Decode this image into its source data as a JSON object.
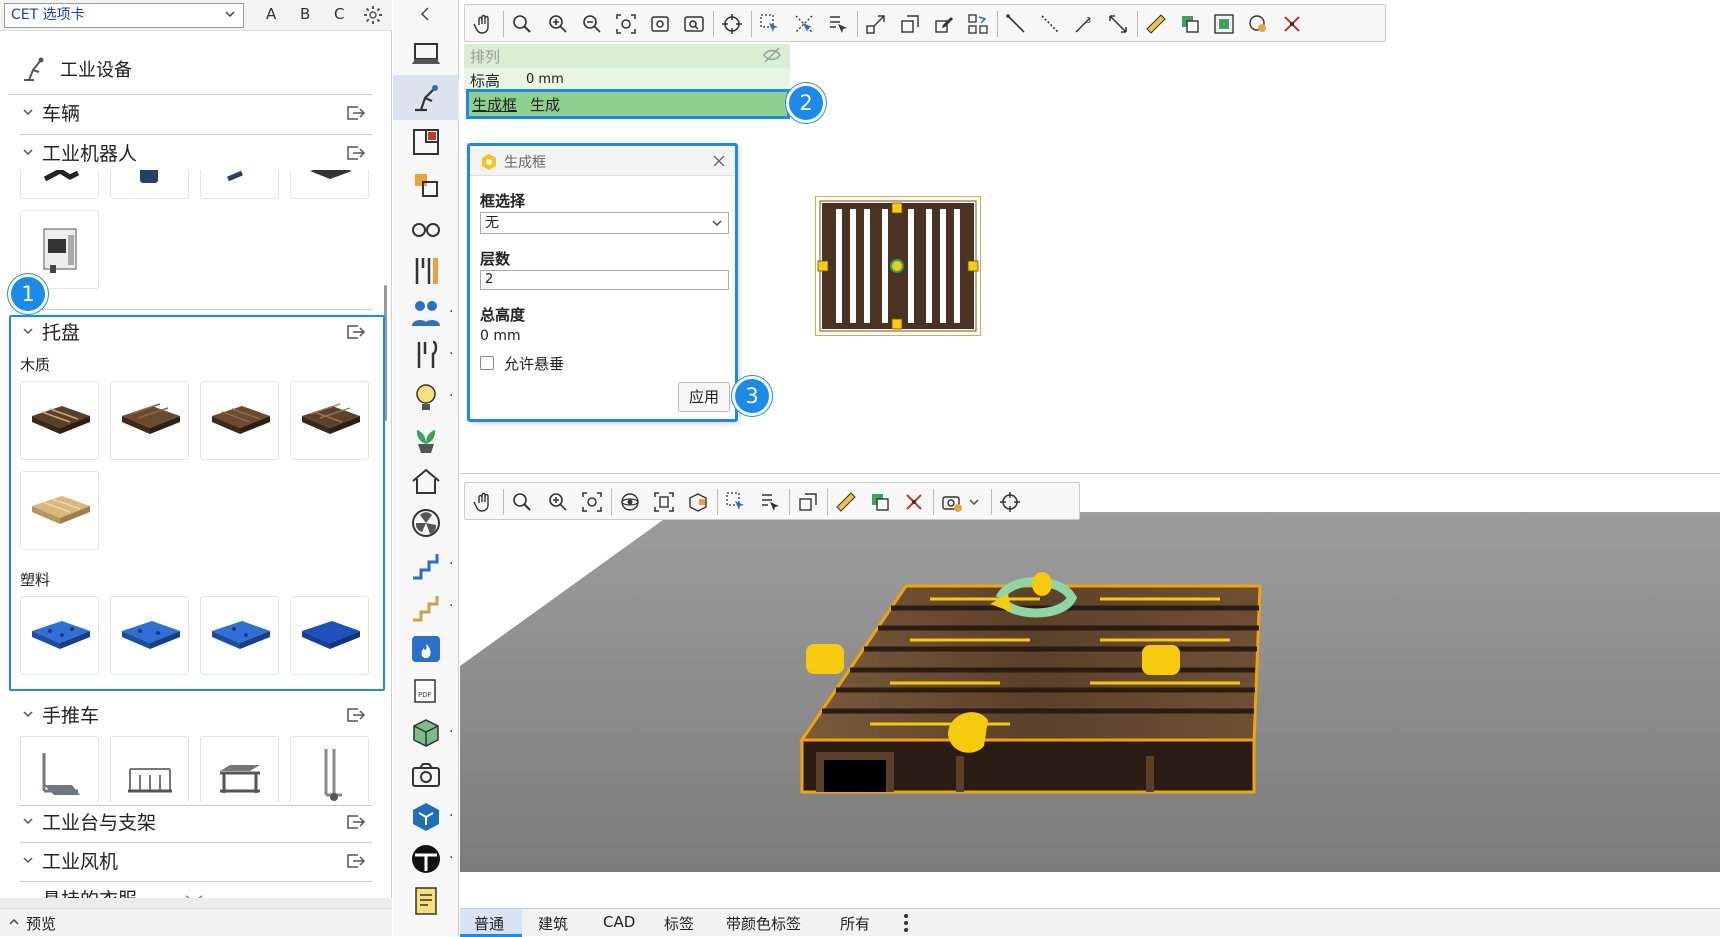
{
  "app": {
    "tab_selector": "CET 选项卡",
    "letters": [
      "A",
      "B",
      "C"
    ],
    "collapse_glyph": "‹"
  },
  "library": {
    "header": "工业设备",
    "categories": {
      "vehicles": "车辆",
      "robots": "工业机器人",
      "pallets": "托盘",
      "trolleys": "手推车",
      "workbench": "工业台与支架",
      "fans": "工业风机",
      "partial": "悬挂的衣服"
    },
    "pallet_sub": {
      "wood": "木质",
      "plastic": "塑料"
    },
    "preview": "预览"
  },
  "markers": [
    "1",
    "2",
    "3"
  ],
  "properties": {
    "row1_label": "排列",
    "row2_label": "标高",
    "row2_value": "0 mm",
    "row3_label": "生成框",
    "row3_value": "生成"
  },
  "dialog": {
    "title": "生成框",
    "frame_select_label": "框选择",
    "frame_select_value": "无",
    "layers_label": "层数",
    "layers_value": "2",
    "total_height_label": "总高度",
    "total_height_value": "0 mm",
    "allow_hang_label": "允许悬垂",
    "allow_hang_checked": false,
    "apply_button": "应用"
  },
  "bottom_tabs": [
    "普通",
    "建筑",
    "CAD",
    "标签",
    "带颜色标签",
    "所有"
  ],
  "bottom_active": "普通",
  "colors": {
    "accent": "#1a8bea",
    "prop_green": "#d9eed2",
    "gen_green": "#8fd08f",
    "floor": "#8a8a8a",
    "wood": "#4a3322",
    "gizmo": "#f5cb0b"
  }
}
